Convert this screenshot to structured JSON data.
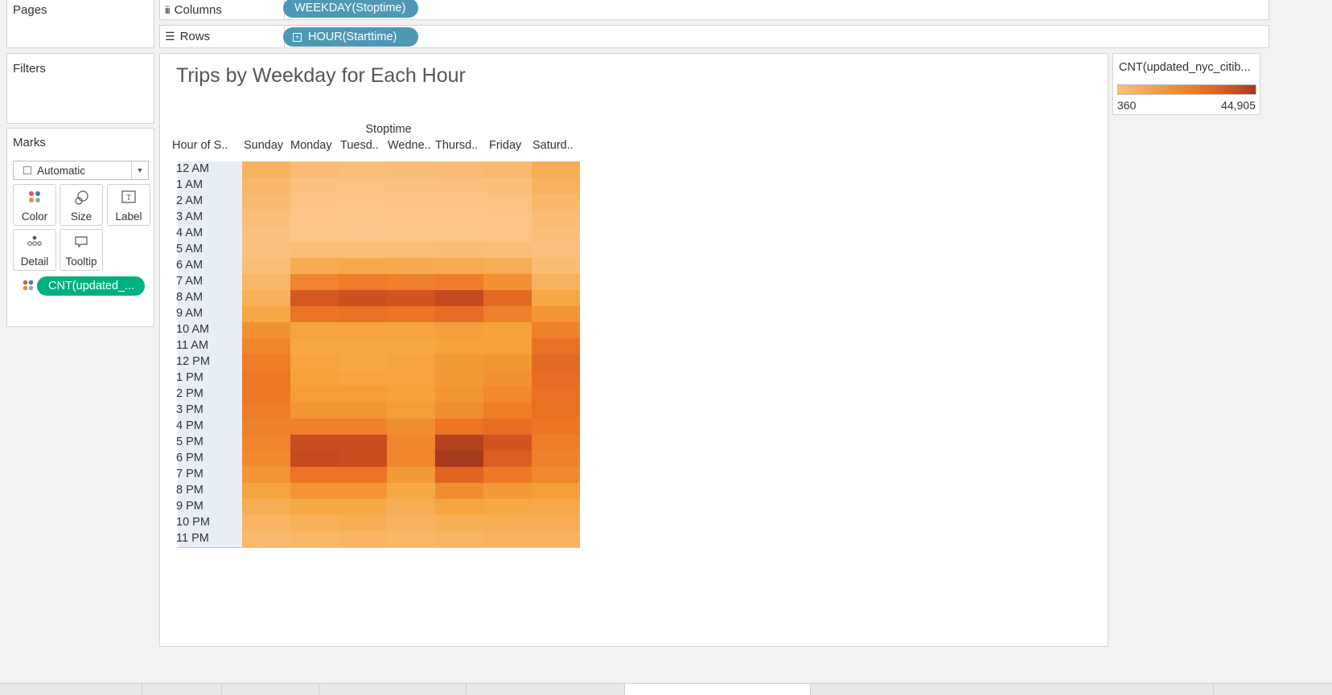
{
  "sidebar": {
    "pages_label": "Pages",
    "filters_label": "Filters",
    "marks_label": "Marks",
    "mark_type": "Automatic",
    "mark_cards": [
      {
        "label": "Color",
        "icon": "color-dots-icon"
      },
      {
        "label": "Size",
        "icon": "size-circles-icon"
      },
      {
        "label": "Label",
        "icon": "label-text-icon"
      },
      {
        "label": "Detail",
        "icon": "detail-dots-icon"
      },
      {
        "label": "Tooltip",
        "icon": "tooltip-bubble-icon"
      }
    ],
    "color_pill": "CNT(updated_..."
  },
  "shelves": {
    "columns_label": "Columns",
    "columns_pill": "WEEKDAY(Stoptime)",
    "rows_label": "Rows",
    "rows_pill": "HOUR(Starttime)"
  },
  "legend": {
    "title": "CNT(updated_nyc_citib...",
    "min_label": "360",
    "max_label": "44,905",
    "color_low": "#fbbf78",
    "color_high": "#a63a1f"
  },
  "chart_data": {
    "type": "heatmap",
    "title": "Trips by Weekday for Each Hour",
    "column_group_label": "Stoptime",
    "row_header": "Hour of S..",
    "columns": [
      "Sunday",
      "Monday",
      "Tuesd..",
      "Wedne..",
      "Thursd..",
      "Friday",
      "Saturd.."
    ],
    "rows": [
      "12 AM",
      "1 AM",
      "2 AM",
      "3 AM",
      "4 AM",
      "5 AM",
      "6 AM",
      "7 AM",
      "8 AM",
      "9 AM",
      "10 AM",
      "11 AM",
      "12 PM",
      "1 PM",
      "2 PM",
      "3 PM",
      "4 PM",
      "5 PM",
      "6 PM",
      "7 PM",
      "8 PM",
      "9 PM",
      "10 PM",
      "11 PM"
    ],
    "color_range": [
      360,
      44905
    ],
    "values": [
      [
        9000,
        4500,
        4000,
        4300,
        5000,
        6000,
        11000
      ],
      [
        7000,
        2500,
        2200,
        2400,
        2800,
        3500,
        9000
      ],
      [
        5500,
        1500,
        1300,
        1500,
        1800,
        2200,
        7000
      ],
      [
        4000,
        900,
        800,
        900,
        1000,
        1300,
        5000
      ],
      [
        2500,
        700,
        600,
        700,
        800,
        1000,
        3500
      ],
      [
        2500,
        4000,
        3800,
        4000,
        4200,
        4000,
        3000
      ],
      [
        4000,
        12000,
        13000,
        12500,
        12000,
        11000,
        5000
      ],
      [
        7000,
        23000,
        25000,
        24000,
        25000,
        20000,
        9000
      ],
      [
        10000,
        35000,
        37000,
        36000,
        39000,
        30000,
        14000
      ],
      [
        14000,
        27000,
        28000,
        27000,
        29000,
        24000,
        19000
      ],
      [
        20000,
        15000,
        15000,
        15000,
        17000,
        16000,
        24000
      ],
      [
        23000,
        14000,
        14000,
        14000,
        16000,
        16000,
        28000
      ],
      [
        25000,
        15000,
        14000,
        15000,
        18000,
        19000,
        30000
      ],
      [
        26000,
        16000,
        15000,
        15000,
        18000,
        20000,
        29000
      ],
      [
        26000,
        17000,
        17000,
        16000,
        19000,
        22000,
        28000
      ],
      [
        25000,
        19000,
        19000,
        17000,
        21000,
        25000,
        28000
      ],
      [
        24000,
        24000,
        24000,
        21000,
        27000,
        29000,
        27000
      ],
      [
        23000,
        38000,
        38000,
        23000,
        42000,
        36000,
        25000
      ],
      [
        22000,
        39000,
        38000,
        23000,
        44905,
        33000,
        24000
      ],
      [
        19000,
        27000,
        27000,
        18000,
        31000,
        26000,
        22000
      ],
      [
        15000,
        19000,
        19000,
        14000,
        21000,
        18000,
        17000
      ],
      [
        11000,
        14000,
        14000,
        11000,
        15000,
        14000,
        13000
      ],
      [
        8000,
        10000,
        11000,
        9000,
        10500,
        11000,
        11000
      ],
      [
        6000,
        7000,
        8000,
        7000,
        8000,
        9000,
        9000
      ]
    ]
  },
  "status_tabs": [
    "",
    "",
    "",
    "",
    "",
    "",
    "",
    ""
  ]
}
